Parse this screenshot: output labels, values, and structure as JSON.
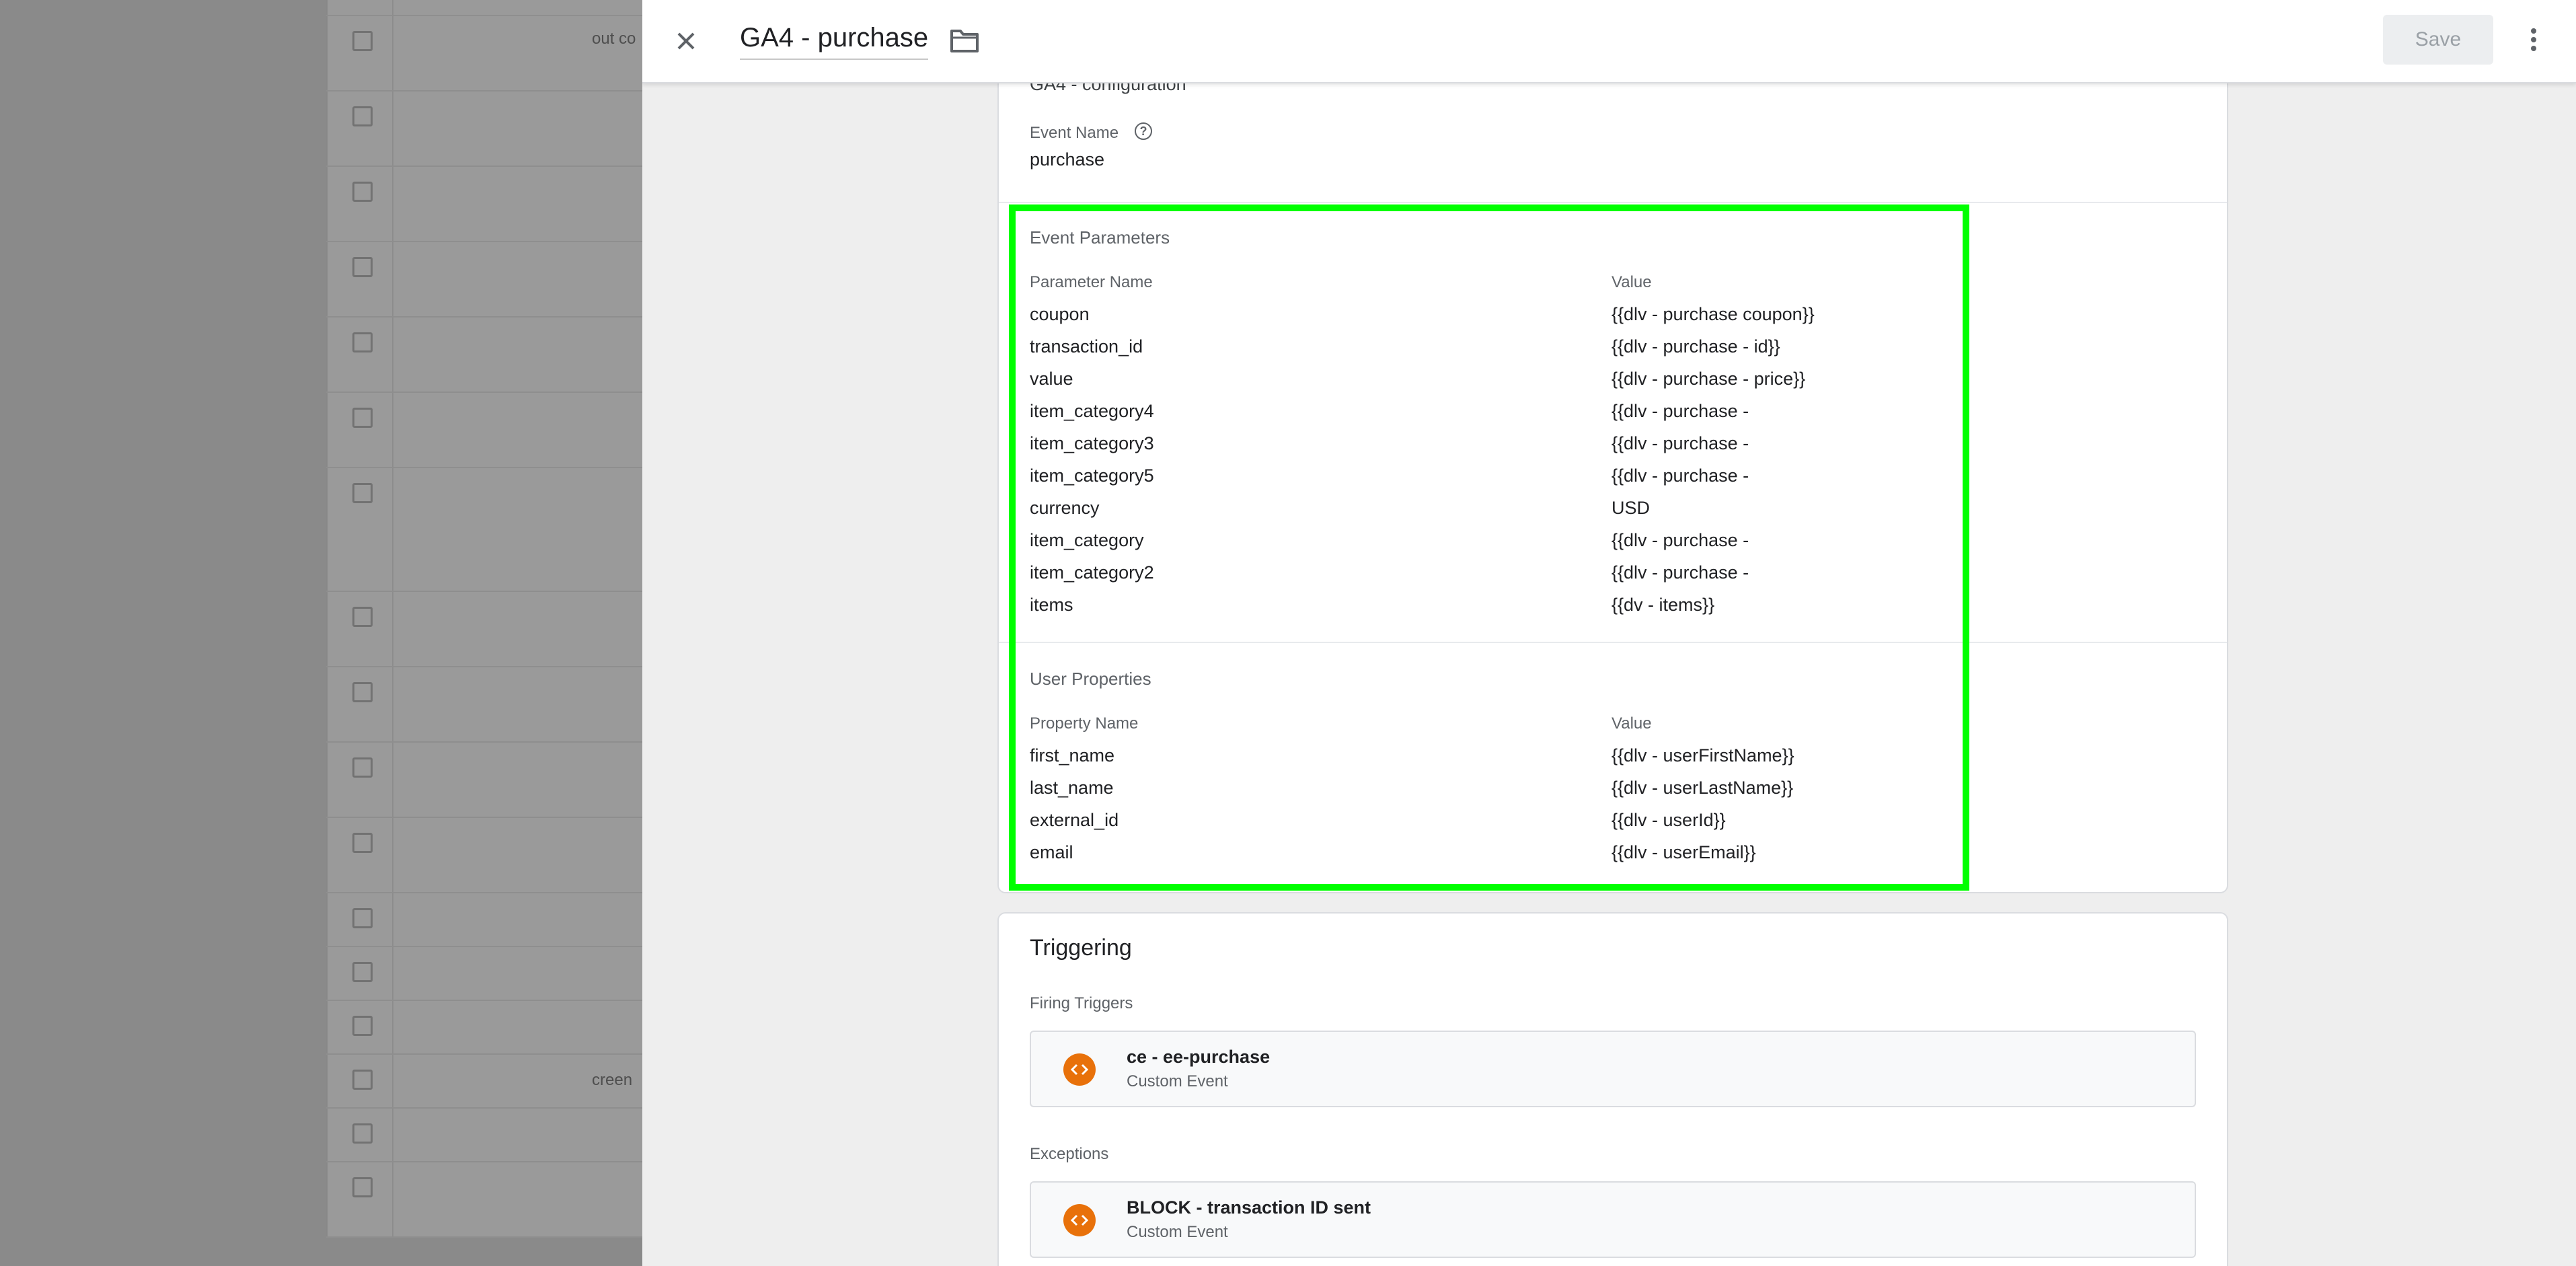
{
  "background": {
    "row_texts": [
      "out co",
      "creen"
    ]
  },
  "header": {
    "title": "GA4 - purchase",
    "save_label": "Save"
  },
  "config": {
    "tag_label_partial": "GA4 - configuration",
    "event_name_label": "Event Name",
    "event_name_value": "purchase"
  },
  "event_parameters": {
    "title": "Event Parameters",
    "col_name": "Parameter Name",
    "col_value": "Value",
    "rows": [
      {
        "name": "coupon",
        "value": "{{dlv - purchase coupon}}"
      },
      {
        "name": "transaction_id",
        "value": "{{dlv - purchase - id}}"
      },
      {
        "name": "value",
        "value": "{{dlv - purchase - price}}"
      },
      {
        "name": "item_category4",
        "value": "{{dlv - purchase -"
      },
      {
        "name": "item_category3",
        "value": "{{dlv - purchase -"
      },
      {
        "name": "item_category5",
        "value": "{{dlv - purchase -"
      },
      {
        "name": "currency",
        "value": "USD"
      },
      {
        "name": "item_category",
        "value": "{{dlv - purchase -"
      },
      {
        "name": "item_category2",
        "value": "{{dlv - purchase -"
      },
      {
        "name": "items",
        "value": "{{dv - items}}"
      }
    ]
  },
  "user_properties": {
    "title": "User Properties",
    "col_name": "Property Name",
    "col_value": "Value",
    "rows": [
      {
        "name": "first_name",
        "value": "{{dlv - userFirstName}}"
      },
      {
        "name": "last_name",
        "value": "{{dlv - userLastName}}"
      },
      {
        "name": "external_id",
        "value": "{{dlv - userId}}"
      },
      {
        "name": "email",
        "value": "{{dlv - userEmail}}"
      }
    ]
  },
  "triggering": {
    "title": "Triggering",
    "firing_label": "Firing Triggers",
    "firing": {
      "name": "ce - ee-purchase",
      "type": "Custom Event"
    },
    "exceptions_label": "Exceptions",
    "exception": {
      "name": "BLOCK - transaction ID sent",
      "type": "Custom Event"
    }
  },
  "colors": {
    "highlight": "#00ff00",
    "trigger_icon": "#e8710a"
  }
}
